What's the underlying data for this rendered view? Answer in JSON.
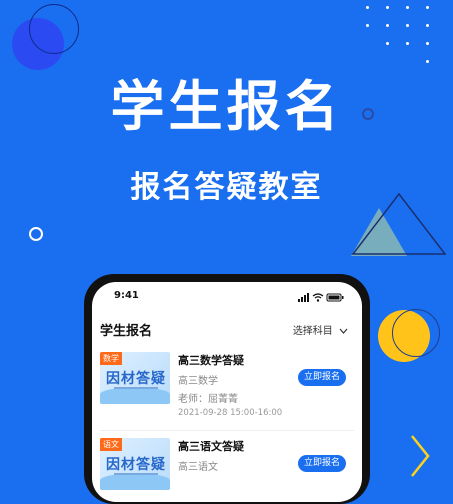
{
  "banner": {
    "headline": "学生报名",
    "subline": "报名答疑教室"
  },
  "status_bar": {
    "time": "9:41"
  },
  "page": {
    "title": "学生报名",
    "subject_select": "选择科目"
  },
  "courses": [
    {
      "tag": "数学",
      "thumb_title": "因材答疑",
      "title": "高三数学答疑",
      "subject": "高三数学",
      "teacher": "老师：屈菁菁",
      "time": "2021-09-28 15:00-16:00",
      "button": "立即报名"
    },
    {
      "tag": "语文",
      "thumb_title": "因材答疑",
      "title": "高三语文答疑",
      "subject": "高三语文",
      "button": "立即报名"
    }
  ],
  "colors": {
    "background": "#1a6ff0",
    "accent": "#1a6ff0",
    "tag": "#ff6a1a",
    "yellow": "#ffc31a"
  }
}
